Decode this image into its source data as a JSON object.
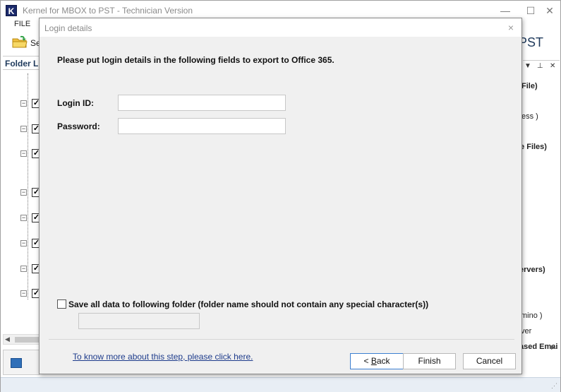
{
  "app": {
    "icon_letter": "K",
    "title": "Kernel for MBOX to PST - Technician Version",
    "minimize": "—",
    "maximize": "☐",
    "close": "✕"
  },
  "menu": {
    "file": "FILE"
  },
  "toolbar": {
    "select_label_partial": "Se"
  },
  "folder_panel": {
    "header_partial": "Folder Lis"
  },
  "right_panel": {
    "title_partial": "PST",
    "ctrl_dropdown": "▼",
    "ctrl_pin": "⊥",
    "ctrl_close": "✕",
    "items": [
      {
        "text": "File)",
        "bold": true
      },
      {
        "text": "ess )",
        "bold": false
      },
      {
        "text": "le Files)",
        "bold": true
      },
      {
        "text": "ervers)",
        "bold": true
      },
      {
        "text": "mino )",
        "bold": false
      },
      {
        "text": "ver",
        "bold": false
      },
      {
        "text": "ased Emai",
        "bold": true
      }
    ]
  },
  "dialog": {
    "title": "Login details",
    "close": "×",
    "instruction": "Please put login details in the following fields to export to Office 365.",
    "login_id_label": "Login ID:",
    "login_id_value": "",
    "password_label": "Password:",
    "password_value": "",
    "save_checkbox_label": "Save all data to following folder (folder name should not contain any special character(s))",
    "save_checked": false,
    "folder_value": "",
    "help_link": "To know more about this step, please click here.",
    "back_prefix": "< ",
    "back_mnemonic": "B",
    "back_rest": "ack",
    "finish": "Finish",
    "cancel": "Cancel"
  }
}
